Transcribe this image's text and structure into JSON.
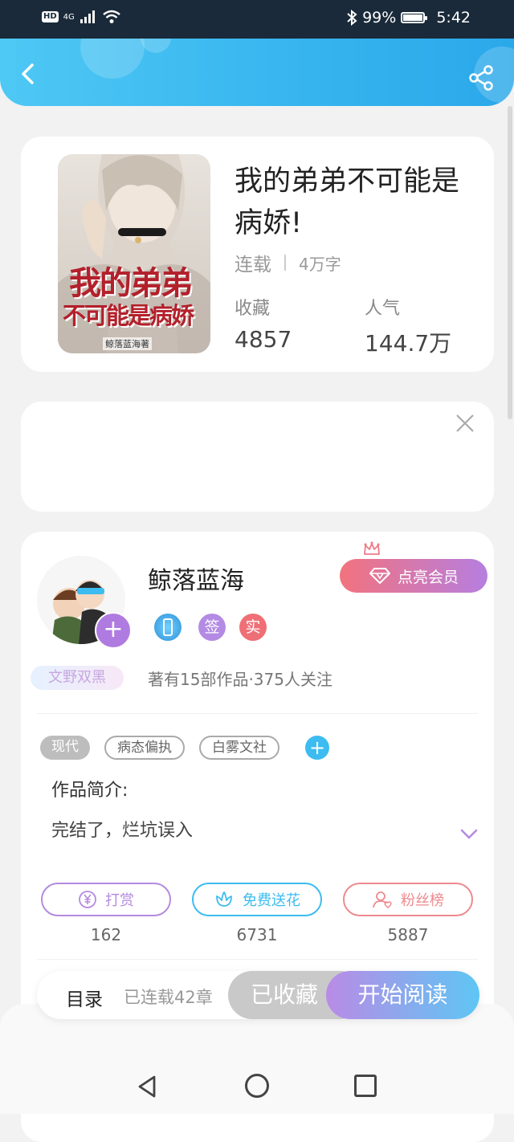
{
  "status_bar": {
    "hd_label": "HD",
    "network": "4G",
    "battery": "99%",
    "battery_level": 0.99,
    "time": "5:42"
  },
  "header": {
    "back_icon": "chevron-left-icon",
    "share_icon": "share-icon"
  },
  "book": {
    "title": "我的弟弟不可能是病娇!",
    "status": "连载",
    "word_count": "4万字",
    "favorites_label": "收藏",
    "favorites_value": "4857",
    "popularity_label": "人气",
    "popularity_value": "144.7万",
    "cover": {
      "title_line1": "我的弟弟",
      "title_line2": "不可能是病娇",
      "author_stamp": "鲸落蓝海著"
    }
  },
  "author": {
    "name": "鲸落蓝海",
    "vip_label": "点亮会员",
    "badges": [
      "签",
      "实"
    ],
    "nickname_tag": "文野双黑",
    "stats": "著有15部作品·375人关注"
  },
  "tags": [
    "现代",
    "病态偏执",
    "白雾文社"
  ],
  "intro": {
    "label": "作品简介:",
    "text": "完结了，烂坑误入"
  },
  "actions": [
    {
      "label": "打赏",
      "count": "162",
      "color": "#b48ae0",
      "icon": "yen-icon"
    },
    {
      "label": "免费送花",
      "count": "6731",
      "color": "#3cbcf0",
      "icon": "flower-icon"
    },
    {
      "label": "粉丝榜",
      "count": "5887",
      "color": "#ee8a8f",
      "icon": "fan-icon"
    }
  ],
  "bottom": {
    "toc_label": "目录",
    "toc_count": "已连载42章",
    "favorited_label": "已收藏",
    "read_label": "开始阅读"
  }
}
